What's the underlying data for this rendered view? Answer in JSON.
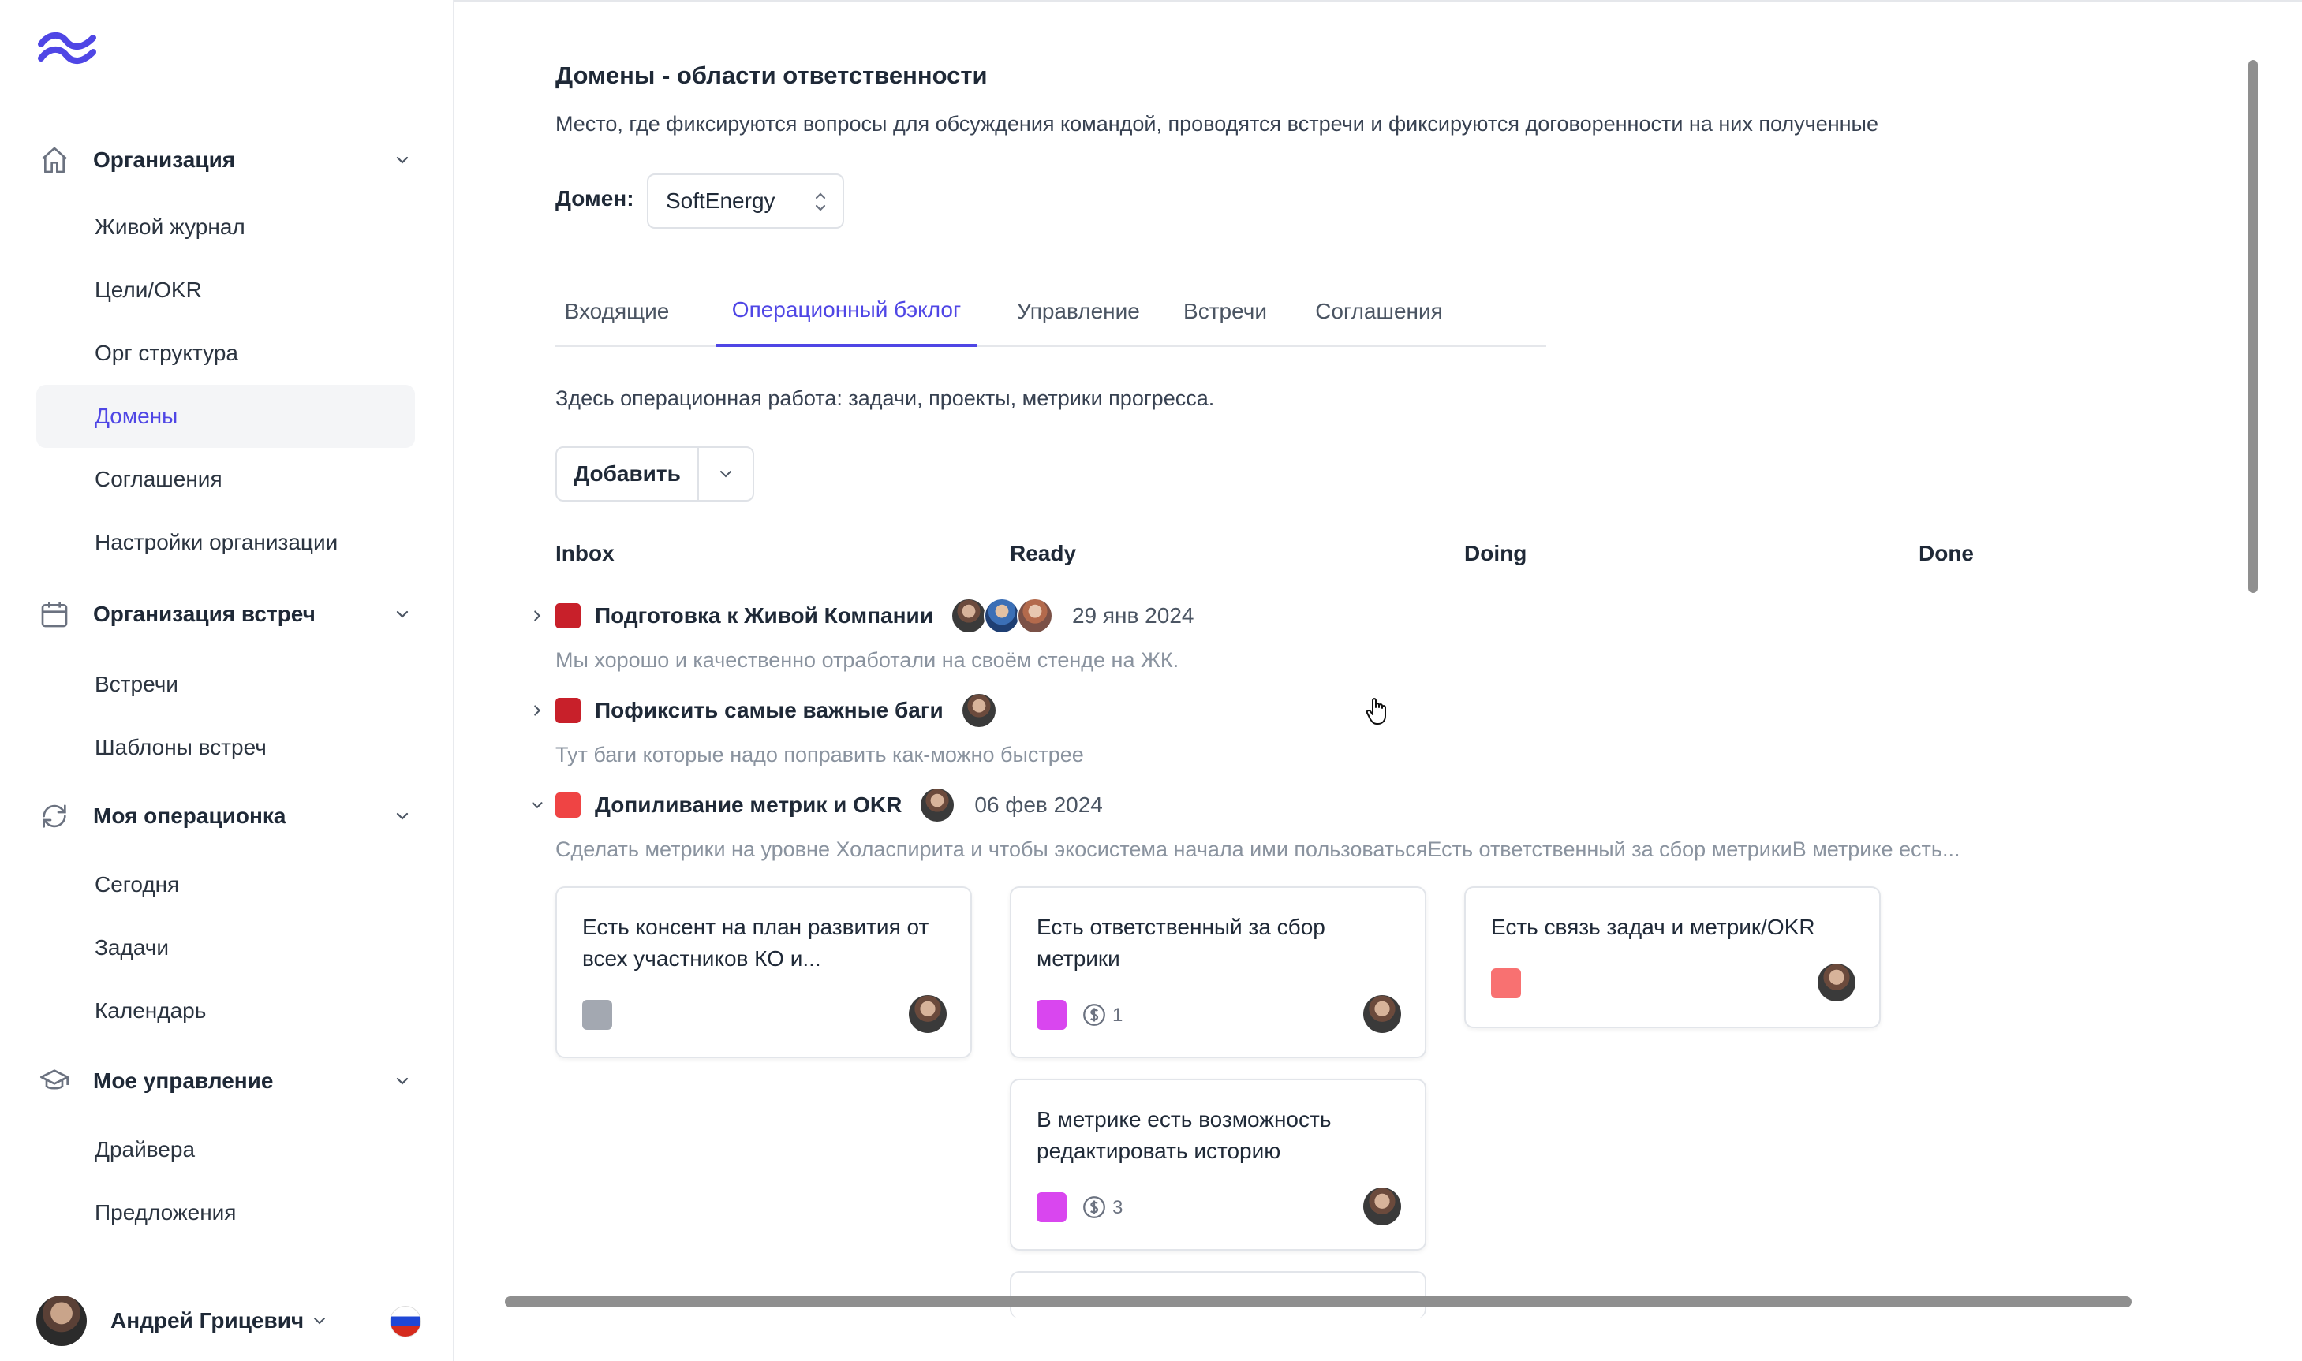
{
  "sidebar": {
    "sections": [
      {
        "label": "Организация",
        "icon": "home-icon"
      },
      {
        "label": "Организация встреч",
        "icon": "calendar-icon"
      },
      {
        "label": "Моя операционка",
        "icon": "refresh-icon"
      },
      {
        "label": "Мое управление",
        "icon": "graduation-cap-icon"
      }
    ],
    "items": [
      {
        "label": "Живой журнал"
      },
      {
        "label": "Цели/OKR"
      },
      {
        "label": "Орг структура"
      },
      {
        "label": "Домены",
        "active": true
      },
      {
        "label": "Соглашения"
      },
      {
        "label": "Настройки организации"
      },
      {
        "label": "Встречи"
      },
      {
        "label": "Шаблоны встреч"
      },
      {
        "label": "Сегодня"
      },
      {
        "label": "Задачи"
      },
      {
        "label": "Календарь"
      },
      {
        "label": "Драйвера"
      },
      {
        "label": "Предложения"
      }
    ],
    "user": {
      "name": "Андрей Грицевич",
      "language_flag": "russia-flag"
    }
  },
  "page": {
    "title": "Домены - области ответственности",
    "description": "Место, где фиксируются вопросы для обсуждения командой, проводятся встречи и фиксируются договоренности на них полученные",
    "domain_label": "Домен:",
    "domain_value": "SoftEnergy",
    "tabs": [
      {
        "label": "Входящие"
      },
      {
        "label": "Операционный бэклог",
        "active": true
      },
      {
        "label": "Управление"
      },
      {
        "label": "Встречи"
      },
      {
        "label": "Соглашения"
      }
    ],
    "tab_note": "Здесь операционная работа: задачи, проекты, метрики прогресса.",
    "add_button": "Добавить"
  },
  "board": {
    "columns": [
      "Inbox",
      "Ready",
      "Doing",
      "Done"
    ],
    "groups": [
      {
        "title": "Подготовка к Живой Компании",
        "color": "#c8202a",
        "expanded": false,
        "date": "29 янв 2024",
        "description": "Мы хорошо и качественно отработали на своём стенде на ЖК."
      },
      {
        "title": "Пофиксить самые важные баги",
        "color": "#c8202a",
        "expanded": false,
        "date": "",
        "description": "Тут баги которые надо поправить как-можно быстрее"
      },
      {
        "title": "Допиливание метрик и OKR",
        "color": "#ef4444",
        "expanded": true,
        "date": "06 фев 2024",
        "description": "Сделать метрики на уровне Холаспирита и чтобы экосистема начала ими пользоватьсяЕсть ответственный за сбор метрикиВ метрике есть..."
      }
    ],
    "cards": [
      {
        "text": "Есть консент на план развития от всех участников КО и...",
        "color": "#a3a8b1",
        "count": ""
      },
      {
        "text": "Есть ответственный за сбор метрики",
        "color": "#d946ef",
        "count": "1"
      },
      {
        "text": "Есть связь задач и метрик/OKR",
        "color": "#f87171",
        "count": ""
      },
      {
        "text": "В метрике есть возможность редактировать историю",
        "color": "#d946ef",
        "count": "3"
      }
    ]
  },
  "colors": {
    "accent": "#4f46e5",
    "active_bg": "#f4f5f7"
  }
}
